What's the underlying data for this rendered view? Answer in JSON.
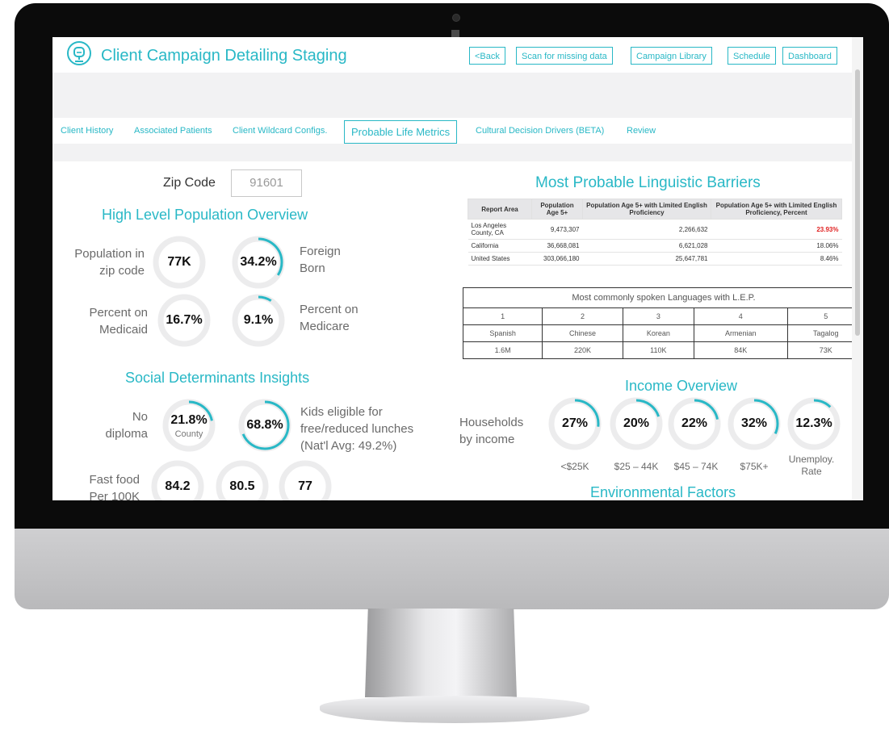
{
  "app": {
    "title": "Client Campaign Detailing Staging",
    "accent_color": "#29b8c6",
    "logo_icon": "headset-icon"
  },
  "nav": {
    "back": "<Back",
    "scan": "Scan for missing data",
    "library": "Campaign Library",
    "schedule": "Schedule",
    "dashboard": "Dashboard"
  },
  "tabs": [
    {
      "label": "Client History"
    },
    {
      "label": "Associated Patients"
    },
    {
      "label": "Client Wildcard Configs."
    },
    {
      "label": "Probable Life Metrics",
      "active": true
    },
    {
      "label": "Cultural Decision Drivers (BETA)"
    },
    {
      "label": "Review"
    }
  ],
  "zip": {
    "label": "Zip Code",
    "value": "91601"
  },
  "population": {
    "title": "High Level Population Overview",
    "pop_label_1": "Population in",
    "pop_label_2": "zip code",
    "pop_value": "77K",
    "foreign_value": "34.2%",
    "foreign_pct": 34.2,
    "foreign_label_1": "Foreign",
    "foreign_label_2": "Born",
    "medicaid_label_1": "Percent on",
    "medicaid_label_2": "Medicaid",
    "medicaid_value": "16.7%",
    "medicare_value": "9.1%",
    "medicare_pct": 9.1,
    "medicare_label_1": "Percent on",
    "medicare_label_2": "Medicare"
  },
  "social": {
    "title": "Social Determinants Insights",
    "diploma_label_1": "No",
    "diploma_label_2": "diploma",
    "diploma_value": "21.8%",
    "diploma_pct": 21.8,
    "diploma_sub": "County",
    "lunch_value": "68.8%",
    "lunch_pct": 68.8,
    "lunch_label_1": "Kids eligible for",
    "lunch_label_2": "free/reduced lunches",
    "lunch_label_3": "(Nat'l Avg: 49.2%)",
    "fastfood_label_1": "Fast food",
    "fastfood_label_2": "Per 100K",
    "fastfood_values": [
      "84.2",
      "80.5",
      "77"
    ]
  },
  "linguistic": {
    "title": "Most Probable Linguistic Barriers",
    "headers": [
      "Report Area",
      "Population Age 5+",
      "Population Age 5+ with Limited English Proficiency",
      "Population Age 5+ with Limited English Proficiency, Percent"
    ],
    "rows": [
      [
        "Los Angeles County, CA",
        "9,473,307",
        "2,266,632",
        "23.93%"
      ],
      [
        "California",
        "36,668,081",
        "6,621,028",
        "18.06%"
      ],
      [
        "United States",
        "303,066,180",
        "25,647,781",
        "8.46%"
      ]
    ],
    "highlight_color": "#e02020"
  },
  "languages": {
    "title": "Most commonly spoken Languages with L.E.P.",
    "ranks": [
      "1",
      "2",
      "3",
      "4",
      "5"
    ],
    "names": [
      "Spanish",
      "Chinese",
      "Korean",
      "Armenian",
      "Tagalog"
    ],
    "counts": [
      "1.6M",
      "220K",
      "110K",
      "84K",
      "73K"
    ]
  },
  "income": {
    "title": "Income Overview",
    "label_1": "Households",
    "label_2": "by income",
    "items": [
      {
        "value": "27%",
        "pct": 27,
        "label": "<$25K"
      },
      {
        "value": "20%",
        "pct": 20,
        "label": "$25 – 44K"
      },
      {
        "value": "22%",
        "pct": 22,
        "label": "$45 – 74K"
      },
      {
        "value": "32%",
        "pct": 32,
        "label": "$75K+"
      },
      {
        "value": "12.3%",
        "pct": 12.3,
        "label_1": "Unemploy.",
        "label_2": "Rate"
      }
    ]
  },
  "environment": {
    "title": "Environmental Factors"
  }
}
